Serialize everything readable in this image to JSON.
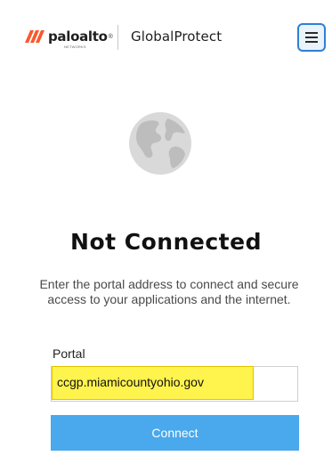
{
  "header": {
    "brand_name": "paloalto",
    "brand_registered": "®",
    "brand_subtext": "NETWORKS",
    "product_title": "GlobalProtect",
    "menu_icon": "hamburger-menu-icon"
  },
  "status": {
    "icon": "globe-icon",
    "title": "Not Connected",
    "description": "Enter the portal address to connect and secure access to your applications and the internet."
  },
  "portal": {
    "label": "Portal",
    "value": "ccgp.miamicountyohio.gov",
    "placeholder": ""
  },
  "actions": {
    "connect_label": "Connect"
  },
  "colors": {
    "accent": "#2f7fd4",
    "connect_button": "#4aa8ec",
    "highlight": "#fff34d",
    "logo_orange": "#fa582d",
    "globe": "#d6d6d6"
  }
}
